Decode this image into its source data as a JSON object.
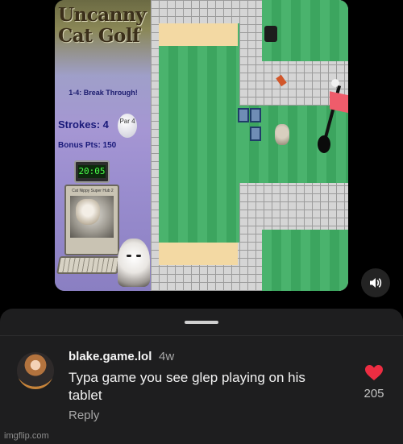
{
  "video": {
    "game_title": "Uncanny Cat Golf",
    "level_name": "1-4: Break Through!",
    "strokes": "Strokes: 4",
    "par": "Par 4",
    "bonus": "Bonus Pts: 150",
    "timer": "20:05",
    "screen_caption": "Cat Nippy Super Hub 2",
    "sound_icon": "speaker-icon"
  },
  "comment": {
    "username": "blake.game.lol",
    "time": "4w",
    "text": "Typa game you see glep playing on his tablet",
    "reply_label": "Reply",
    "like_count": "205",
    "like_color": "#ed2d42"
  },
  "watermark": "imgflip.com"
}
